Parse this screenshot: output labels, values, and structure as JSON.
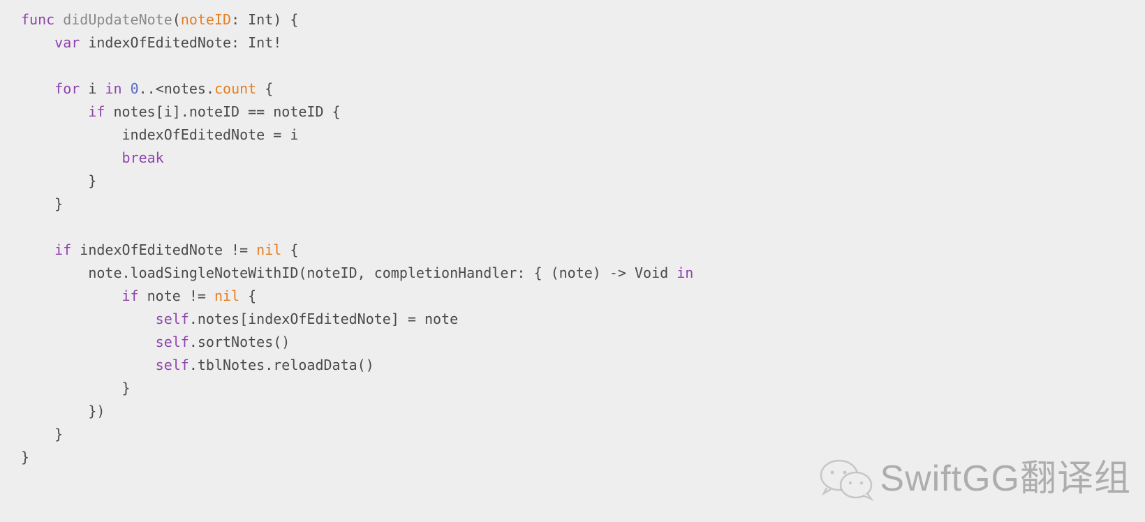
{
  "code": {
    "l1": {
      "kw_func": "func",
      "fn_name": "didUpdateNote",
      "paren_open": "(",
      "param": "noteID",
      "colon_type": ": Int",
      "paren_close": ")",
      "brace": " {"
    },
    "l2": {
      "indent": "    ",
      "kw_var": "var",
      "decl": " indexOfEditedNote: Int!"
    },
    "l3": "",
    "l4": {
      "indent": "    ",
      "kw_for": "for",
      "sp1": " i ",
      "kw_in": "in",
      "sp2": " ",
      "zero": "0",
      "range": "..<notes.",
      "count": "count",
      "brace": " {"
    },
    "l5": {
      "indent": "        ",
      "kw_if": "if",
      "cond": " notes[i].noteID == noteID {"
    },
    "l6": {
      "indent": "            ",
      "stmt": "indexOfEditedNote = i"
    },
    "l7": {
      "indent": "            ",
      "kw_break": "break"
    },
    "l8": {
      "indent": "        ",
      "brace": "}"
    },
    "l9": {
      "indent": "    ",
      "brace": "}"
    },
    "l10": "",
    "l11": {
      "indent": "    ",
      "kw_if": "if",
      "pre": " indexOfEditedNote != ",
      "nil": "nil",
      "brace": " {"
    },
    "l12": {
      "indent": "        ",
      "pre": "note.loadSingleNoteWithID(noteID, completionHandler: { (note) -> Void ",
      "kw_in": "in"
    },
    "l13": {
      "indent": "            ",
      "kw_if": "if",
      "pre": " note != ",
      "nil": "nil",
      "brace": " {"
    },
    "l14": {
      "indent": "                ",
      "kw_self": "self",
      "rest": ".notes[indexOfEditedNote] = note"
    },
    "l15": {
      "indent": "                ",
      "kw_self": "self",
      "rest": ".sortNotes()"
    },
    "l16": {
      "indent": "                ",
      "kw_self": "self",
      "rest": ".tblNotes.reloadData()"
    },
    "l17": {
      "indent": "            ",
      "brace": "}"
    },
    "l18": {
      "indent": "        ",
      "brace": "})"
    },
    "l19": {
      "indent": "    ",
      "brace": "}"
    },
    "l20": {
      "brace": "}"
    }
  },
  "watermark": {
    "text": "SwiftGG翻译组"
  }
}
